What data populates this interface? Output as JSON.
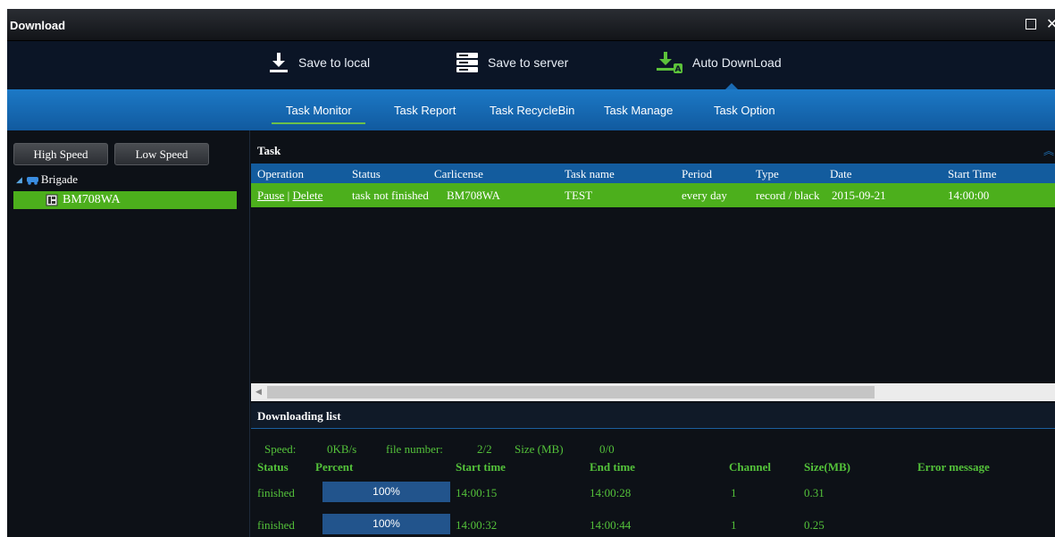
{
  "window": {
    "title": "Download",
    "maximize_icon": "maximize-icon",
    "close_icon": "close-icon"
  },
  "toolbar": {
    "items": [
      {
        "label": "Save to local",
        "icon": "download-arrow-icon"
      },
      {
        "label": "Save to server",
        "icon": "server-icon"
      },
      {
        "label": "Auto DownLoad",
        "icon": "auto-download-icon"
      }
    ]
  },
  "tabs": [
    {
      "label": "Task Monitor",
      "active": true
    },
    {
      "label": "Task Report"
    },
    {
      "label": "Task RecycleBin"
    },
    {
      "label": "Task Manage"
    },
    {
      "label": "Task Option"
    }
  ],
  "left": {
    "high_speed": "High Speed",
    "low_speed": "Low Speed",
    "tree_root": "Brigade",
    "tree_child": "BM708WA"
  },
  "task": {
    "title": "Task",
    "columns": [
      "Operation",
      "Status",
      "Carlicense",
      "Task name",
      "Period",
      "Type",
      "Date",
      "Start Time"
    ],
    "row": {
      "pause": "Pause",
      "sep": " | ",
      "delete": "Delete",
      "status": "task not finished",
      "carlicense": "BM708WA",
      "task_name": "TEST",
      "period": "every day",
      "type": "record / black",
      "date": "2015-09-21",
      "start_time": "14:00:00"
    }
  },
  "downloading": {
    "title": "Downloading list",
    "speed_label": "Speed:",
    "speed_value": "0KB/s",
    "file_number_label": "file number:",
    "file_number_value": "2/2",
    "size_label": "Size (MB)",
    "size_value": "0/0",
    "columns": [
      "Status",
      "Percent",
      "Start time",
      "End time",
      "Channel",
      "Size(MB)",
      "Error message"
    ],
    "rows": [
      {
        "status": "finished",
        "percent": "100%",
        "start": "14:00:15",
        "end": "14:00:28",
        "channel": "1",
        "size": "0.31"
      },
      {
        "status": "finished",
        "percent": "100%",
        "start": "14:00:32",
        "end": "14:00:44",
        "channel": "1",
        "size": "0.25"
      }
    ]
  },
  "colors": {
    "accent_green": "#4caf1c",
    "accent_blue": "#135c9e",
    "text_green": "#54c23a"
  }
}
